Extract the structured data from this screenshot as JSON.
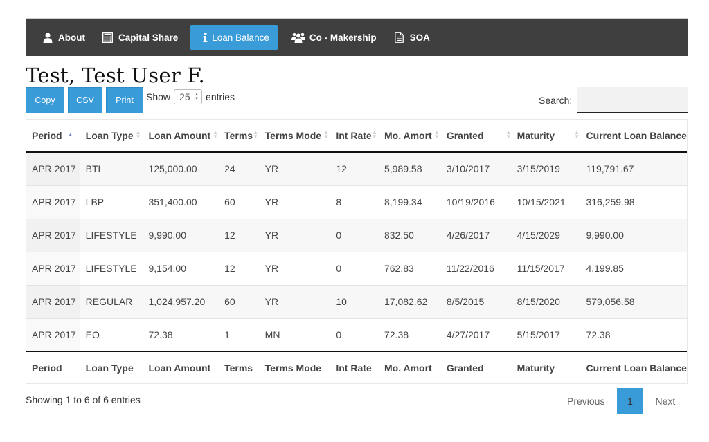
{
  "nav": {
    "items": [
      {
        "label": "About",
        "icon": "user-icon",
        "active": false
      },
      {
        "label": "Capital Share",
        "icon": "calculator-icon",
        "active": false
      },
      {
        "label": "Loan Balance",
        "icon": "info-icon",
        "active": true
      },
      {
        "label": "Co - Makership",
        "icon": "users-icon",
        "active": false
      },
      {
        "label": "SOA",
        "icon": "document-icon",
        "active": false
      }
    ]
  },
  "user_name": "Test, Test User F.",
  "toolbar": {
    "copy_label": "Copy",
    "csv_label": "CSV",
    "print_label": "Print",
    "show_label": "Show",
    "entries_label": "entries",
    "page_length": "25",
    "search_label": "Search:",
    "search_value": ""
  },
  "table": {
    "columns": [
      "Period",
      "Loan Type",
      "Loan Amount",
      "Terms",
      "Terms Mode",
      "Int Rate",
      "Mo. Amort",
      "Granted",
      "Maturity",
      "Current Loan Balance"
    ],
    "sorted_column": "Period",
    "sort_direction": "asc",
    "rows": [
      [
        "APR 2017",
        "BTL",
        "125,000.00",
        "24",
        "YR",
        "12",
        "5,989.58",
        "3/10/2017",
        "3/15/2019",
        "119,791.67"
      ],
      [
        "APR 2017",
        "LBP",
        "351,400.00",
        "60",
        "YR",
        "8",
        "8,199.34",
        "10/19/2016",
        "10/15/2021",
        "316,259.98"
      ],
      [
        "APR 2017",
        "LIFESTYLE",
        "9,990.00",
        "12",
        "YR",
        "0",
        "832.50",
        "4/26/2017",
        "4/15/2029",
        "9,990.00"
      ],
      [
        "APR 2017",
        "LIFESTYLE",
        "9,154.00",
        "12",
        "YR",
        "0",
        "762.83",
        "11/22/2016",
        "11/15/2017",
        "4,199.85"
      ],
      [
        "APR 2017",
        "REGULAR",
        "1,024,957.20",
        "60",
        "YR",
        "10",
        "17,082.62",
        "8/5/2015",
        "8/15/2020",
        "579,056.58"
      ],
      [
        "APR 2017",
        "EO",
        "72.38",
        "1",
        "MN",
        "0",
        "72.38",
        "4/27/2017",
        "5/15/2017",
        "72.38"
      ]
    ]
  },
  "footer": {
    "info": "Showing 1 to 6 of 6 entries",
    "previous_label": "Previous",
    "current_page": "1",
    "next_label": "Next"
  }
}
